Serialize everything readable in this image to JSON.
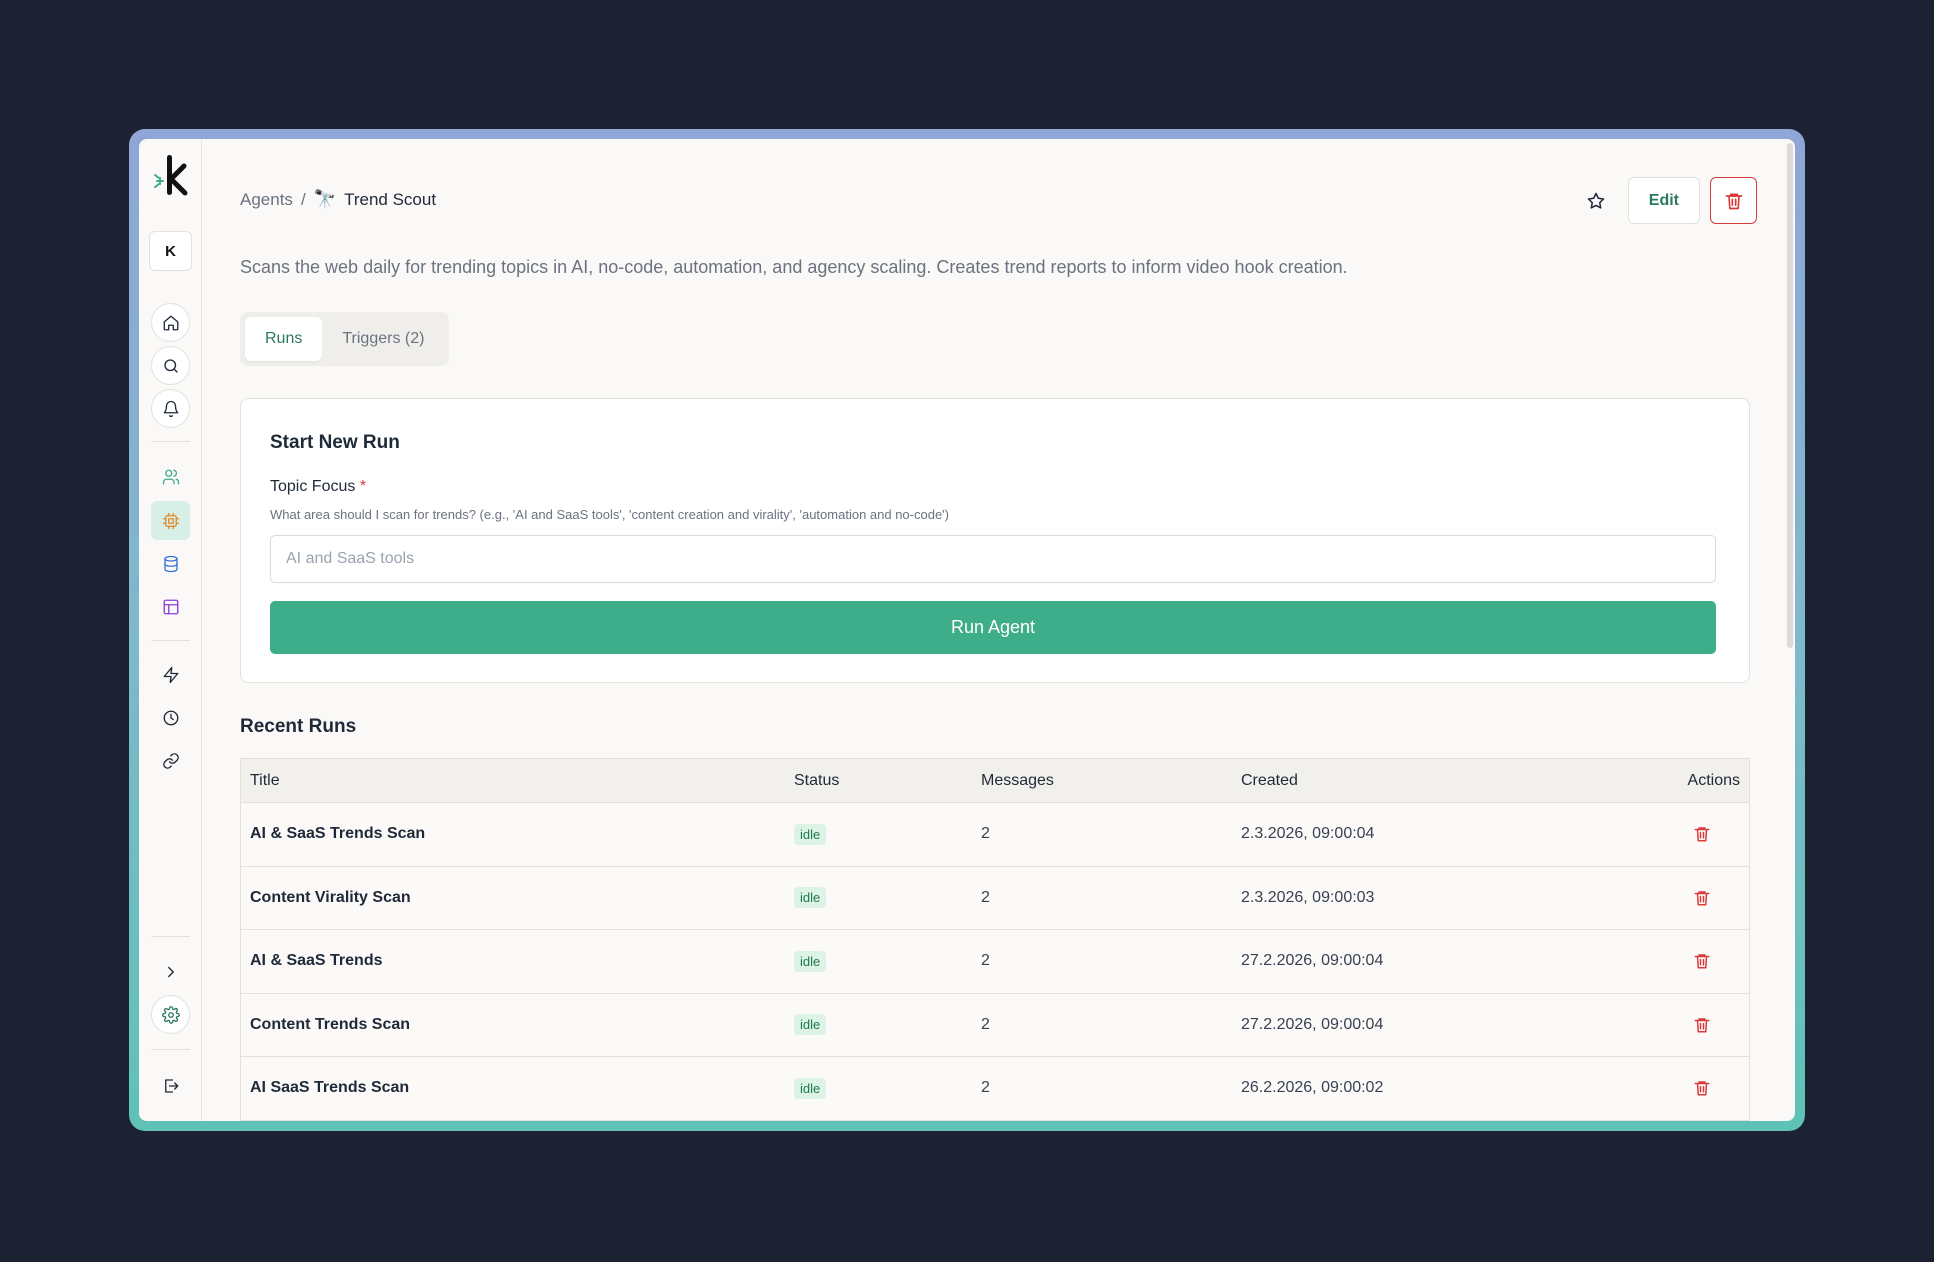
{
  "workspace_initial": "K",
  "breadcrumb": {
    "parent": "Agents",
    "separator": "/",
    "agent_emoji": "🔭",
    "agent_name": "Trend Scout"
  },
  "actions": {
    "edit_label": "Edit"
  },
  "description": "Scans the web daily for trending topics in AI, no-code, automation, and agency scaling. Creates trend reports to inform video hook creation.",
  "tabs": [
    {
      "label": "Runs",
      "active": true
    },
    {
      "label": "Triggers (2)",
      "active": false
    }
  ],
  "new_run": {
    "title": "Start New Run",
    "field_label": "Topic Focus",
    "required_marker": "*",
    "help": "What area should I scan for trends? (e.g., 'AI and SaaS tools', 'content creation and virality', 'automation and no-code')",
    "placeholder": "AI and SaaS tools",
    "value": "",
    "button": "Run Agent"
  },
  "recent_runs": {
    "title": "Recent Runs",
    "columns": [
      "Title",
      "Status",
      "Messages",
      "Created",
      "Actions"
    ],
    "rows": [
      {
        "title": "AI & SaaS Trends Scan",
        "status": "idle",
        "messages": "2",
        "created": "2.3.2026, 09:00:04"
      },
      {
        "title": "Content Virality Scan",
        "status": "idle",
        "messages": "2",
        "created": "2.3.2026, 09:00:03"
      },
      {
        "title": "AI & SaaS Trends",
        "status": "idle",
        "messages": "2",
        "created": "27.2.2026, 09:00:04"
      },
      {
        "title": "Content Trends Scan",
        "status": "idle",
        "messages": "2",
        "created": "27.2.2026, 09:00:04"
      },
      {
        "title": "AI SaaS Trends Scan",
        "status": "idle",
        "messages": "2",
        "created": "26.2.2026, 09:00:02"
      }
    ]
  },
  "colors": {
    "accent": "#3ead8a",
    "danger": "#d93a3a",
    "brand_text": "#2c7a5e",
    "badge_bg": "#dcf3e6"
  }
}
